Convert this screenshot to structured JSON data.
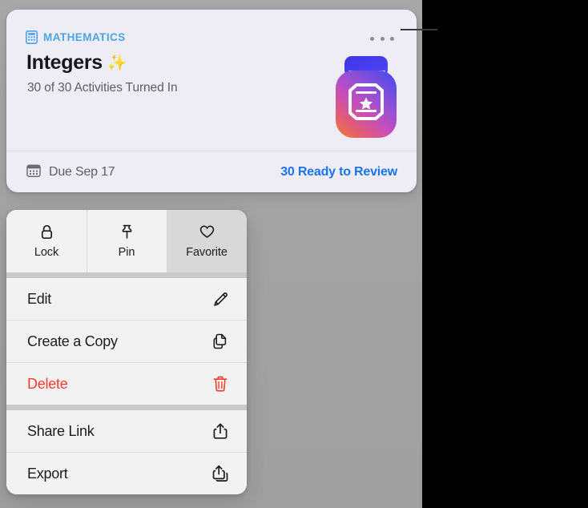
{
  "card": {
    "subject": "MATHEMATICS",
    "subject_icon": "calculator-icon",
    "subject_color": "#4ba3e8",
    "title": "Integers",
    "title_emoji": "✨",
    "progress_text": "30 of 30 Activities Turned In",
    "app_icon": "schoolwork-app-icon",
    "more_button": {
      "icon": "ellipsis-icon",
      "label": "More"
    },
    "footer": {
      "due_icon": "calendar-icon",
      "due_text": "Due Sep 17",
      "review_link": "30 Ready to Review",
      "review_link_color": "#1a73f0"
    },
    "background_color": "#eeedf5"
  },
  "context_menu": {
    "tiles": [
      {
        "label": "Lock",
        "icon": "lock-icon",
        "highlighted": false
      },
      {
        "label": "Pin",
        "icon": "pin-icon",
        "highlighted": false
      },
      {
        "label": "Favorite",
        "icon": "heart-icon",
        "highlighted": true
      }
    ],
    "groups": [
      {
        "items": [
          {
            "label": "Edit",
            "icon": "pencil-icon",
            "destructive": false
          },
          {
            "label": "Create a Copy",
            "icon": "copy-icon",
            "destructive": false
          },
          {
            "label": "Delete",
            "icon": "trash-icon",
            "destructive": true
          }
        ]
      },
      {
        "items": [
          {
            "label": "Share Link",
            "icon": "share-icon",
            "destructive": false
          },
          {
            "label": "Export",
            "icon": "export-icon",
            "destructive": false
          }
        ]
      }
    ],
    "destructive_color": "#ff3b30"
  },
  "annotation": {
    "callout_line": true,
    "callout_color": "#3a3a3c"
  }
}
